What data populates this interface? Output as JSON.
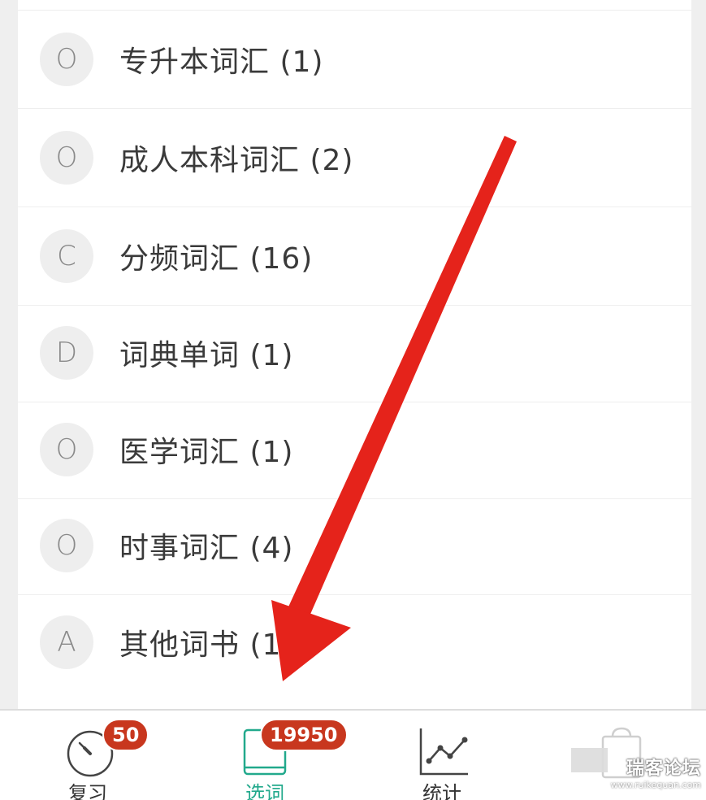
{
  "list": {
    "items": [
      {
        "letter": "O",
        "label": "专升本词汇 (1)"
      },
      {
        "letter": "O",
        "label": "成人本科词汇 (2)"
      },
      {
        "letter": "C",
        "label": "分频词汇 (16)"
      },
      {
        "letter": "D",
        "label": "词典单词 (1)"
      },
      {
        "letter": "O",
        "label": "医学词汇 (1)"
      },
      {
        "letter": "O",
        "label": "时事词汇 (4)"
      },
      {
        "letter": "A",
        "label": "其他词书 (1"
      }
    ]
  },
  "tabbar": {
    "review": {
      "label": "复习",
      "badge": "50",
      "icon": "timer-icon"
    },
    "select": {
      "label": "选词",
      "badge": "19950",
      "icon": "book-icon",
      "active": true
    },
    "stats": {
      "label": "统计",
      "icon": "line-chart-icon"
    },
    "more": {
      "icon": "clipboard-icon"
    }
  },
  "watermark": {
    "text": "瑞客论坛",
    "sub": "www.ruikequan.com"
  },
  "colors": {
    "accent": "#22a98c",
    "badge": "#c8371e",
    "arrow": "#e5231b"
  }
}
